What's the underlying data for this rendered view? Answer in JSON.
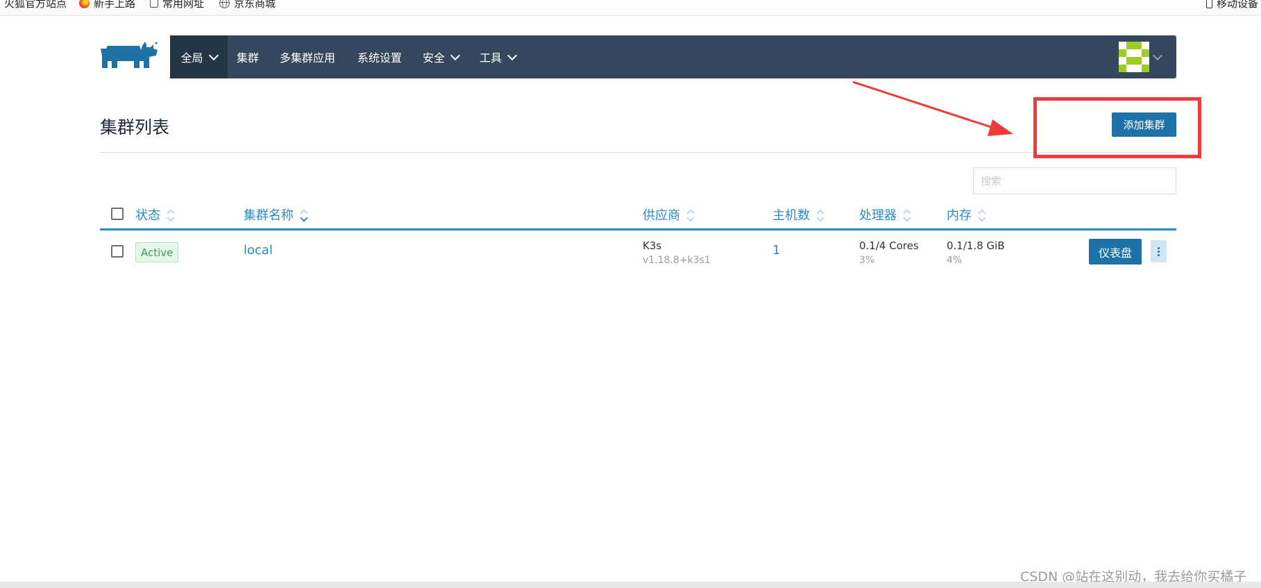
{
  "bookmarks": [
    {
      "label": "火狐官方站点",
      "icon": "bookmark-icon"
    },
    {
      "label": "新手上路",
      "icon": "firefox-icon"
    },
    {
      "label": "常用网址",
      "icon": "folder-icon"
    },
    {
      "label": "京东商城",
      "icon": "globe-icon"
    }
  ],
  "mobile_bookmarks": {
    "label": "移动设备",
    "icon": "phone-icon"
  },
  "nav": {
    "items": [
      {
        "label": "全局",
        "has_dropdown": true,
        "active": true
      },
      {
        "label": "集群",
        "has_dropdown": false
      },
      {
        "label": "多集群应用",
        "has_dropdown": false
      },
      {
        "label": "系统设置",
        "has_dropdown": false
      },
      {
        "label": "安全",
        "has_dropdown": true
      },
      {
        "label": "工具",
        "has_dropdown": true
      }
    ]
  },
  "page": {
    "title": "集群列表",
    "add_button": "添加集群",
    "search_placeholder": "搜索"
  },
  "table": {
    "headers": [
      "状态",
      "集群名称",
      "供应商",
      "主机数",
      "处理器",
      "内存"
    ],
    "sort_active": "集群名称",
    "rows": [
      {
        "status": "Active",
        "name": "local",
        "provider": "K3s",
        "version": "v1.18.8+k3s1",
        "hosts": "1",
        "cpu": "0.1/4 Cores",
        "cpu_pct": "3%",
        "memory": "0.1/1.8 GiB",
        "memory_pct": "4%",
        "dashboard_button": "仪表盘"
      }
    ]
  },
  "watermark": "CSDN @站在这别动，我去给你买橘子",
  "colors": {
    "navbar": "#34475c",
    "navbar_active": "#243545",
    "primary": "#1f72a7",
    "link": "#2b8cc6",
    "status_active": "#3f9a56",
    "annotation": "#f03a3a",
    "avatar": "#9dcc24"
  }
}
